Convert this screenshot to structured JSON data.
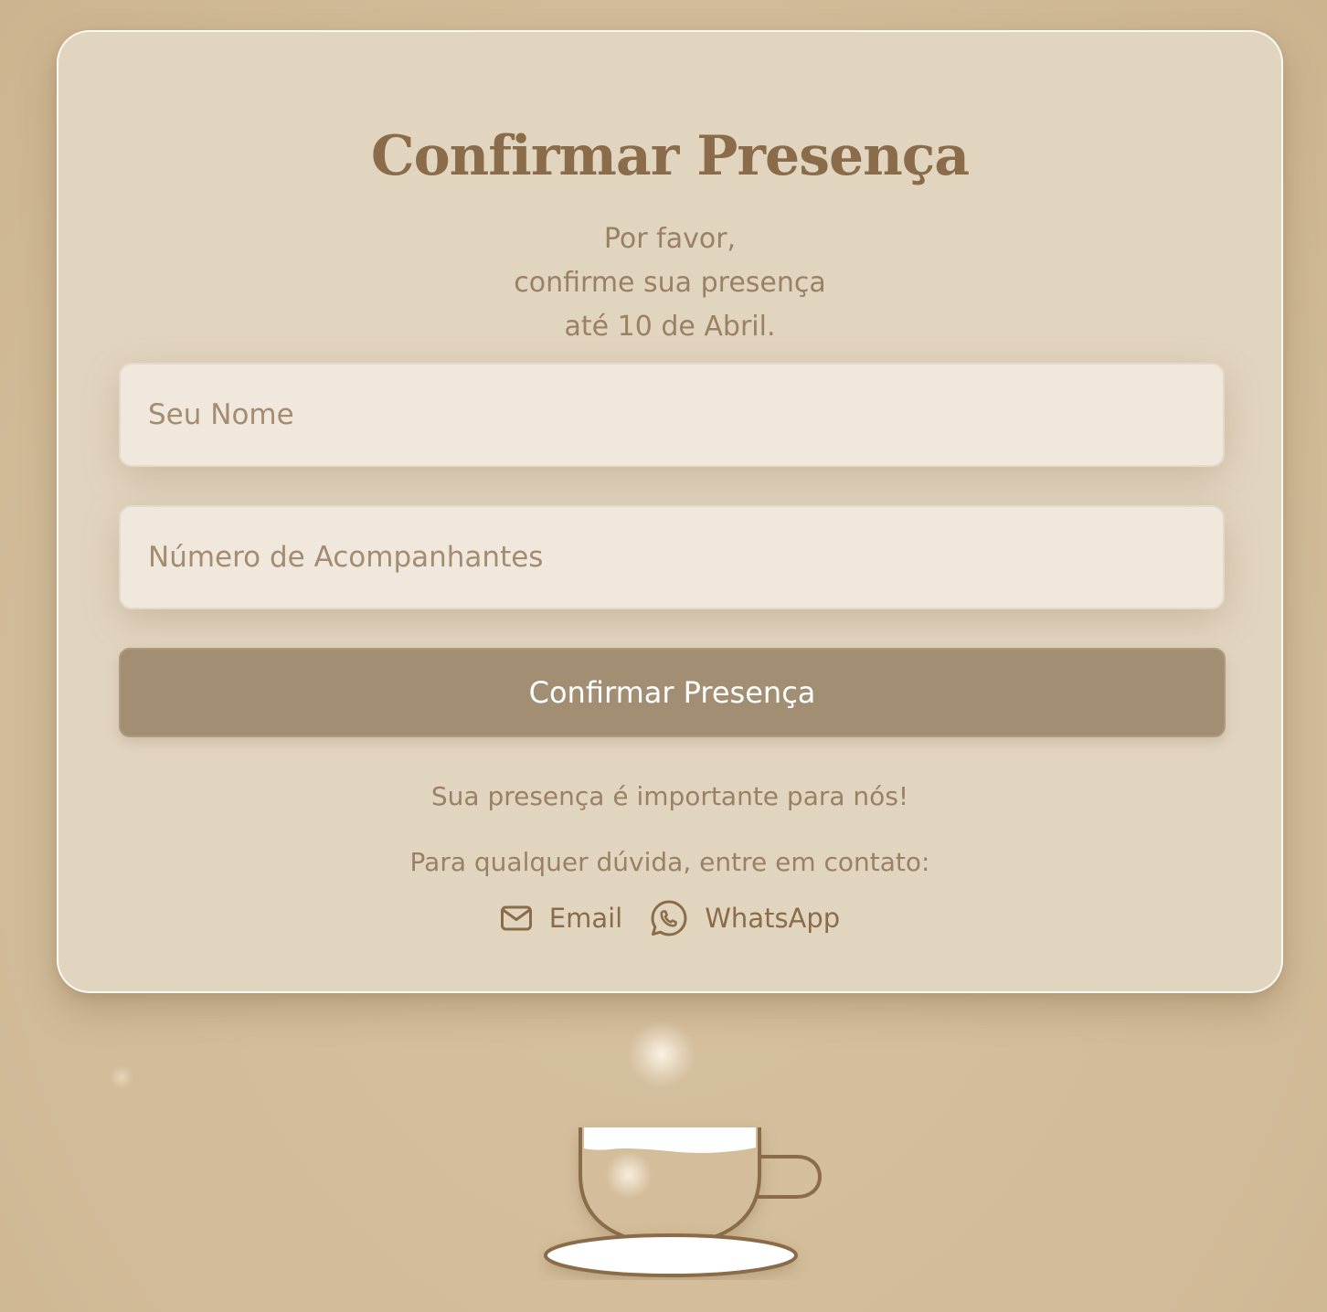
{
  "rsvp": {
    "title": "Confirmar Presença",
    "subtitle_lines": [
      "Por favor,",
      "confirme sua presença",
      "até 10 de Abril."
    ],
    "name_placeholder": "Seu Nome",
    "guests_placeholder": "Número de Acompanhantes",
    "submit_label": "Confirmar Presença",
    "note": "Sua presença é importante para nós!",
    "contact_text": "Para qualquer dúvida, entre em contato:",
    "links": [
      {
        "label": "Email",
        "icon": "envelope-icon"
      },
      {
        "label": "WhatsApp",
        "icon": "whatsapp-icon"
      }
    ]
  },
  "theme": {
    "background": "#d4bd9b",
    "card": "#e2d5c0",
    "accent": "#8a6c4a",
    "button": "#a28f73",
    "input": "#f0e8dc"
  }
}
